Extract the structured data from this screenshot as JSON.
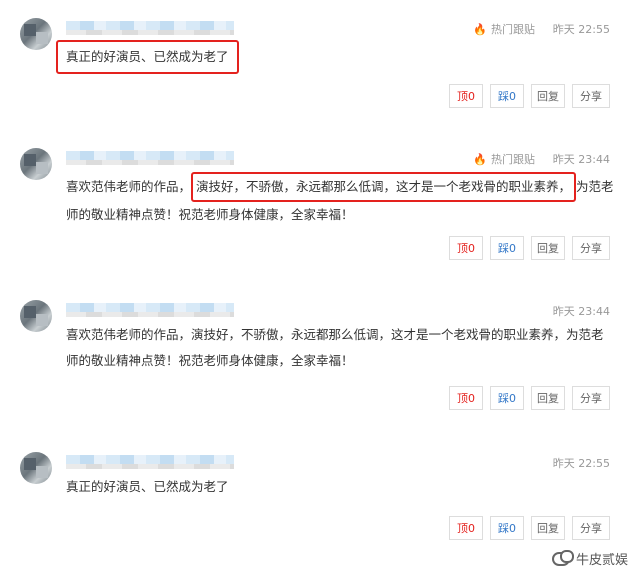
{
  "comments": [
    {
      "hot_label": "热门跟贴",
      "time": "昨天 22:55",
      "text_before": "",
      "text_highlight": "真正的好演员、已然成为老了",
      "text_after": "",
      "actions": {
        "up": "顶0",
        "down": "踩0",
        "reply": "回复",
        "share": "分享"
      }
    },
    {
      "hot_label": "热门跟贴",
      "time": "昨天 23:44",
      "text_before": "喜欢范伟老师的作品，",
      "text_highlight": "演技好，不骄傲，永远都那么低调，这才是一个老戏骨的职业素养，",
      "text_after": "为范老师的敬业精神点赞！祝范老师身体健康，全家幸福！",
      "actions": {
        "up": "顶0",
        "down": "踩0",
        "reply": "回复",
        "share": "分享"
      }
    },
    {
      "hot_label": "",
      "time": "昨天 23:44",
      "text_before": "喜欢范伟老师的作品，演技好，不骄傲，永远都那么低调，这才是一个老戏骨的职业素养，为范老师的敬业精神点赞！祝范老师身体健康，全家幸福！",
      "text_highlight": "",
      "text_after": "",
      "actions": {
        "up": "顶0",
        "down": "踩0",
        "reply": "回复",
        "share": "分享"
      }
    },
    {
      "hot_label": "",
      "time": "昨天 22:55",
      "text_before": "真正的好演员、已然成为老了",
      "text_highlight": "",
      "text_after": "",
      "actions": {
        "up": "顶0",
        "down": "踩0",
        "reply": "回复",
        "share": "分享"
      }
    }
  ],
  "watermark": {
    "icon": "wechat-icon",
    "text": "牛皮贰娱"
  },
  "colors": {
    "highlight_border": "#e4221e",
    "up_color": "#e4221e",
    "down_color": "#3478c8",
    "hot_icon": "#e2423b"
  }
}
